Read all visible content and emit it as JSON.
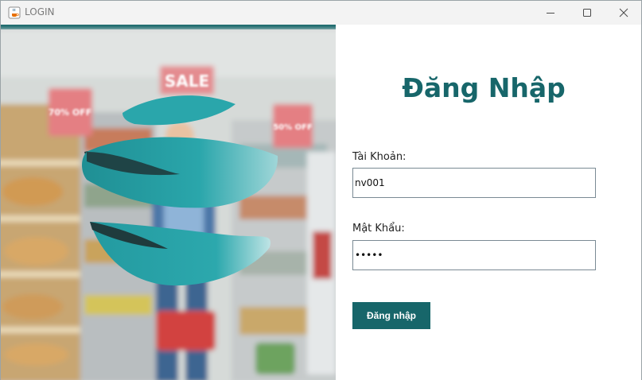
{
  "window": {
    "title": "LOGIN",
    "icon": "java-cup-icon",
    "controls": [
      "minimize-icon",
      "maximize-icon",
      "close-icon"
    ]
  },
  "illustration": {
    "description_icon": "brand-logo-swoosh",
    "sign_texts": [
      "SALE",
      "70% OFF",
      "50% OFF"
    ]
  },
  "form": {
    "heading": "Đăng Nhập",
    "username_label": "Tài Khoản:",
    "username_value": "nv001",
    "password_label": "Mật Khẩu:",
    "password_value": "•••••",
    "submit_label": "Đăng nhập"
  },
  "colors": {
    "accent": "#17666a",
    "logo_teal": "#2aa6ab",
    "logo_dark": "#1f3b3d"
  }
}
